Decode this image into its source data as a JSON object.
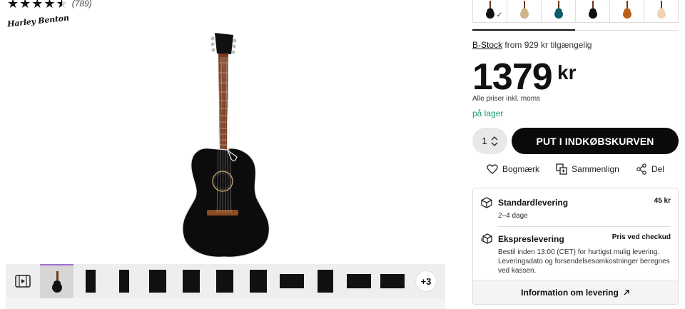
{
  "product": {
    "rating": {
      "stars": 4.5,
      "count": "(789)"
    },
    "brand_logo": "Harley Benton"
  },
  "thumbnails": {
    "more_label": "+3"
  },
  "swatches": {
    "colors": [
      "#111111",
      "#d2b48c",
      "#0e5a6a",
      "#111111",
      "#b8601c",
      "#f2d3b8"
    ],
    "selected_index": 0
  },
  "buy": {
    "bstock_link": "B-Stock",
    "bstock_text": "from 929 kr tilgængelig",
    "price": "1379",
    "currency": "kr",
    "vat_note": "Alle priser inkl. moms",
    "stock_status": "på lager",
    "quantity": "1",
    "cart_button": "PUT I INDKØBSKURVEN",
    "bookmark": "Bogmærk",
    "compare": "Sammenlign",
    "share": "Del"
  },
  "delivery": {
    "standard": {
      "title": "Standardlevering",
      "price": "45 kr",
      "time": "2–4 dage"
    },
    "express": {
      "title": "Ekspreslevering",
      "price": "Pris ved checkud",
      "desc": "Bestil inden 13:00 (CET) for hurtigst mulig levering. Leveringsdato og forsendelsesomkostninger beregnes ved kassen."
    },
    "info_link": "Information om levering"
  }
}
